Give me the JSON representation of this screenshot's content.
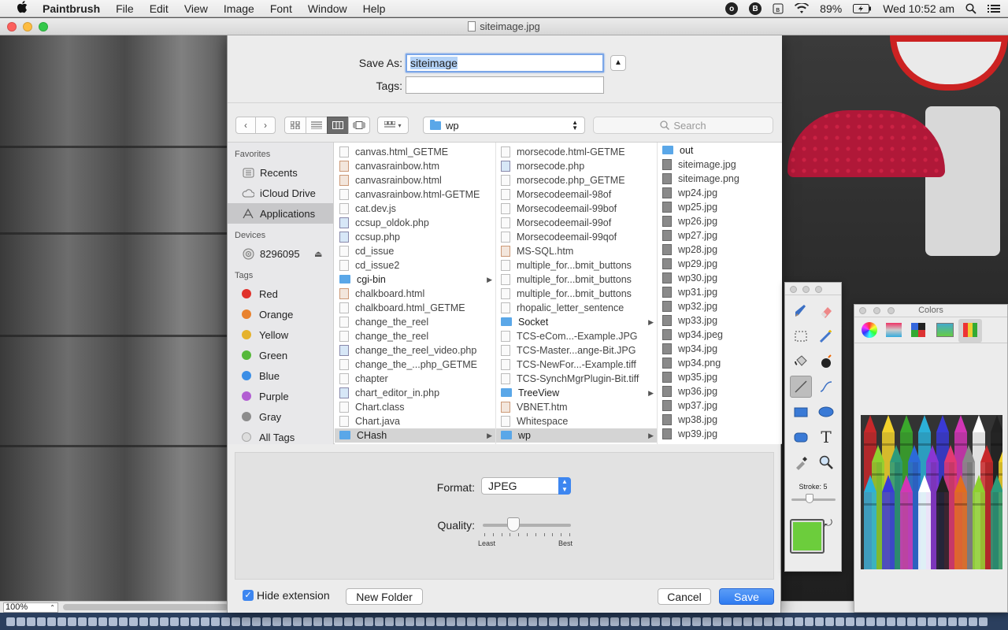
{
  "menubar": {
    "app_name": "Paintbrush",
    "items": [
      "File",
      "Edit",
      "View",
      "Image",
      "Font",
      "Window",
      "Help"
    ],
    "battery": "89%",
    "clock": "Wed 10:52 am",
    "status_icons": [
      "o-circle-icon",
      "b-circle-icon",
      "bluetooth-icon",
      "wifi-icon",
      "battery-icon",
      "search-icon",
      "list-icon"
    ]
  },
  "window": {
    "title": "siteimage.jpg",
    "zoom": "100%"
  },
  "save_sheet": {
    "save_as_label": "Save As:",
    "filename": "siteimage",
    "tags_label": "Tags:",
    "tags_value": "",
    "path_folder": "wp",
    "search_placeholder": "Search",
    "sidebar": {
      "favorites_header": "Favorites",
      "favorites": [
        {
          "label": "Recents",
          "icon": "recents-icon"
        },
        {
          "label": "iCloud Drive",
          "icon": "cloud-icon"
        },
        {
          "label": "Applications",
          "icon": "applications-icon",
          "selected": true
        }
      ],
      "devices_header": "Devices",
      "devices": [
        {
          "label": "8296095",
          "icon": "disk-icon",
          "eject": "⏏"
        }
      ],
      "tags_header": "Tags",
      "tags": [
        {
          "label": "Red",
          "color": "#e0322c"
        },
        {
          "label": "Orange",
          "color": "#e8822f"
        },
        {
          "label": "Yellow",
          "color": "#e5b22c"
        },
        {
          "label": "Green",
          "color": "#56b83a"
        },
        {
          "label": "Blue",
          "color": "#3b8ee6"
        },
        {
          "label": "Purple",
          "color": "#b25ed2"
        },
        {
          "label": "Gray",
          "color": "#8c8c8c"
        },
        {
          "label": "All Tags",
          "color": "#dddddd"
        }
      ]
    },
    "columns": [
      [
        {
          "name": "canvas.html_GETME",
          "kind": "file"
        },
        {
          "name": "canvasrainbow.htm",
          "kind": "htm"
        },
        {
          "name": "canvasrainbow.html",
          "kind": "htm"
        },
        {
          "name": "canvasrainbow.html-GETME",
          "kind": "file"
        },
        {
          "name": "cat.dev.js",
          "kind": "file"
        },
        {
          "name": "ccsup_oldok.php",
          "kind": "php"
        },
        {
          "name": "ccsup.php",
          "kind": "php"
        },
        {
          "name": "cd_issue",
          "kind": "file"
        },
        {
          "name": "cd_issue2",
          "kind": "file"
        },
        {
          "name": "cgi-bin",
          "kind": "folder",
          "arrow": true
        },
        {
          "name": "chalkboard.html",
          "kind": "htm"
        },
        {
          "name": "chalkboard.html_GETME",
          "kind": "file"
        },
        {
          "name": "change_the_reel",
          "kind": "file"
        },
        {
          "name": "change_the_reel",
          "kind": "file"
        },
        {
          "name": "change_the_reel_video.php",
          "kind": "php"
        },
        {
          "name": "change_the_...php_GETME",
          "kind": "file"
        },
        {
          "name": "chapter",
          "kind": "file"
        },
        {
          "name": "chart_editor_in.php",
          "kind": "php"
        },
        {
          "name": "Chart.class",
          "kind": "file"
        },
        {
          "name": "Chart.java",
          "kind": "file"
        },
        {
          "name": "CHash",
          "kind": "folder",
          "arrow": true,
          "selected": true
        }
      ],
      [
        {
          "name": "morsecode.html-GETME",
          "kind": "file"
        },
        {
          "name": "morsecode.php",
          "kind": "php"
        },
        {
          "name": "morsecode.php_GETME",
          "kind": "file"
        },
        {
          "name": "Morsecodeemail-98of",
          "kind": "file"
        },
        {
          "name": "Morsecodeemail-99bof",
          "kind": "file"
        },
        {
          "name": "Morsecodeemail-99of",
          "kind": "file"
        },
        {
          "name": "Morsecodeemail-99qof",
          "kind": "file"
        },
        {
          "name": "MS-SQL.htm",
          "kind": "htm"
        },
        {
          "name": "multiple_for...bmit_buttons",
          "kind": "file"
        },
        {
          "name": "multiple_for...bmit_buttons",
          "kind": "file"
        },
        {
          "name": "multiple_for...bmit_buttons",
          "kind": "file"
        },
        {
          "name": "rhopalic_letter_sentence",
          "kind": "file"
        },
        {
          "name": "Socket",
          "kind": "folder",
          "arrow": true
        },
        {
          "name": "TCS-eCom...-Example.JPG",
          "kind": "file"
        },
        {
          "name": "TCS-Master...ange-Bit.JPG",
          "kind": "file"
        },
        {
          "name": "TCS-NewFor...-Example.tiff",
          "kind": "file"
        },
        {
          "name": "TCS-SynchMgrPlugin-Bit.tiff",
          "kind": "file"
        },
        {
          "name": "TreeView",
          "kind": "folder",
          "arrow": true
        },
        {
          "name": "VBNET.htm",
          "kind": "htm"
        },
        {
          "name": "Whitespace",
          "kind": "file"
        },
        {
          "name": "wp",
          "kind": "folder",
          "arrow": true,
          "selected": true
        }
      ],
      [
        {
          "name": "out",
          "kind": "folder"
        },
        {
          "name": "siteimage.jpg",
          "kind": "img"
        },
        {
          "name": "siteimage.png",
          "kind": "img"
        },
        {
          "name": "wp24.jpg",
          "kind": "img"
        },
        {
          "name": "wp25.jpg",
          "kind": "img"
        },
        {
          "name": "wp26.jpg",
          "kind": "img"
        },
        {
          "name": "wp27.jpg",
          "kind": "img"
        },
        {
          "name": "wp28.jpg",
          "kind": "img"
        },
        {
          "name": "wp29.jpg",
          "kind": "img"
        },
        {
          "name": "wp30.jpg",
          "kind": "img"
        },
        {
          "name": "wp31.jpg",
          "kind": "img"
        },
        {
          "name": "wp32.jpg",
          "kind": "img"
        },
        {
          "name": "wp33.jpg",
          "kind": "img"
        },
        {
          "name": "wp34.jpeg",
          "kind": "img"
        },
        {
          "name": "wp34.jpg",
          "kind": "img"
        },
        {
          "name": "wp34.png",
          "kind": "img"
        },
        {
          "name": "wp35.jpg",
          "kind": "img"
        },
        {
          "name": "wp36.jpg",
          "kind": "img"
        },
        {
          "name": "wp37.jpg",
          "kind": "img"
        },
        {
          "name": "wp38.jpg",
          "kind": "img"
        },
        {
          "name": "wp39.jpg",
          "kind": "img"
        }
      ]
    ],
    "format_label": "Format:",
    "format_value": "JPEG",
    "quality_label": "Quality:",
    "quality_value": 0.35,
    "quality_least": "Least",
    "quality_best": "Best",
    "hide_extension_label": "Hide extension",
    "hide_extension_checked": true,
    "new_folder_label": "New Folder",
    "cancel_label": "Cancel",
    "save_label": "Save"
  },
  "tool_palette": {
    "stroke_label": "Stroke: 5",
    "stroke_value": 5,
    "fill_color": "#6ccd3c",
    "stroke_color": "#ffffff"
  },
  "colors_panel": {
    "title": "Colors",
    "crayon_colors": [
      "#c8282a",
      "#e26d1f",
      "#f2d22b",
      "#8ed12f",
      "#3aa82c",
      "#2c9a7a",
      "#2cb0d8",
      "#2c6ad8",
      "#3a3ad6",
      "#8a36d2",
      "#d236b6",
      "#e23a72",
      "#ffffff",
      "#888888",
      "#222222"
    ]
  }
}
